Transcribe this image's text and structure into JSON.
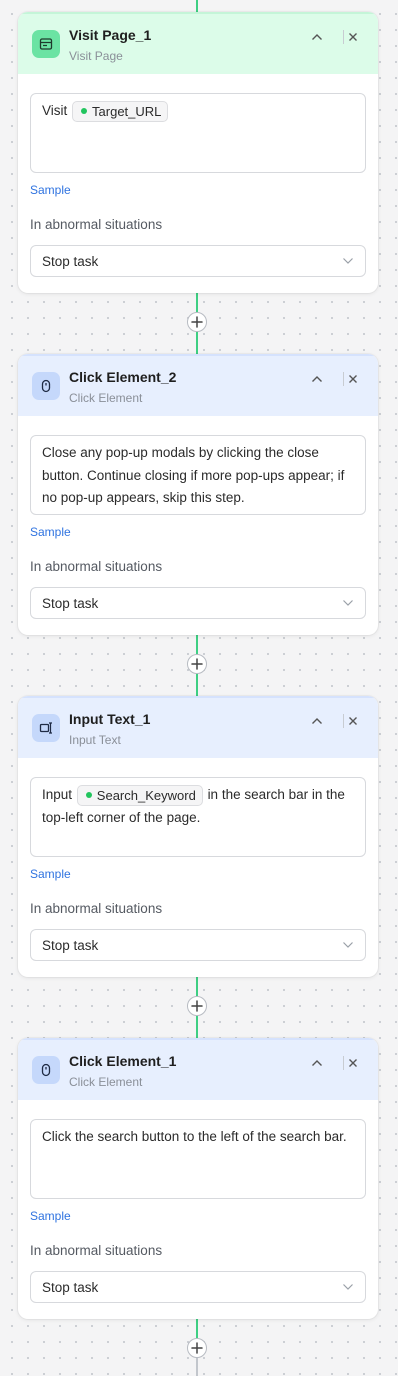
{
  "nodes": [
    {
      "title": "Visit Page_1",
      "subtitle": "Visit Page",
      "icon": "browser-window-icon",
      "prompt_before": "Visit",
      "variable": "Target_URL",
      "prompt_after": "",
      "sample": "Sample",
      "abnormal_label": "In abnormal situations",
      "abnormal_value": "Stop task"
    },
    {
      "title": "Click Element_2",
      "subtitle": "Click Element",
      "icon": "mouse-icon",
      "prompt_text": "Close any pop-up modals by clicking the close button. Continue closing if more pop-ups appear; if no pop-up appears, skip this step.",
      "sample": "Sample",
      "abnormal_label": "In abnormal situations",
      "abnormal_value": "Stop task"
    },
    {
      "title": "Input Text_1",
      "subtitle": "Input Text",
      "icon": "text-cursor-icon",
      "prompt_before": "Input",
      "variable": "Search_Keyword",
      "prompt_after": "in the search bar in the top-left corner of the page.",
      "sample": "Sample",
      "abnormal_label": "In abnormal situations",
      "abnormal_value": "Stop task"
    },
    {
      "title": "Click Element_1",
      "subtitle": "Click Element",
      "icon": "mouse-icon",
      "prompt_text": "Click the search button to the left of the search bar.",
      "sample": "Sample",
      "abnormal_label": "In abnormal situations",
      "abnormal_value": "Stop task"
    }
  ],
  "colors": {
    "accent_green": "#3ecf83",
    "link_blue": "#2f73e0",
    "visit_header": "#dcfce9",
    "action_header": "#e7effe"
  }
}
